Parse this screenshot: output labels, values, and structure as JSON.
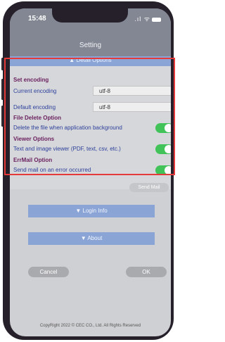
{
  "status_bar": {
    "time": "15:48",
    "icons": ".ıl ᯤ"
  },
  "header": {
    "title": "Setting"
  },
  "detail_options": {
    "label": "▲ Detail Options"
  },
  "settings": {
    "set_encoding_label": "Set encoding",
    "current_encoding_label": "Current encoding",
    "current_encoding_value": "utf-8",
    "default_encoding_label": "Default encoding",
    "default_encoding_value": "utf-8",
    "file_delete_label": "File Delete Option",
    "delete_background_label": "Delete the file when application background",
    "delete_background_on": true,
    "viewer_label": "Viewer Options",
    "viewer_text": "Text and image viewer (PDF, text, csv, etc.)",
    "viewer_on": true,
    "errmail_label": "ErrMail Option",
    "errmail_text": "Send mail on an error occurred",
    "errmail_on": true,
    "send_mail_button": "Send Mail"
  },
  "login_info": {
    "label": "▼ Login Info"
  },
  "about": {
    "label": "▼ About"
  },
  "actions": {
    "cancel": "Cancel",
    "ok": "OK"
  },
  "footer": {
    "copyright": "CopyRight 2022 © CEC CO., Ltd. All Rights Reserved"
  },
  "colors": {
    "highlight_border": "#e43a3a",
    "toggle_on": "#42c35a",
    "accent_blue": "#8aa4d6"
  }
}
